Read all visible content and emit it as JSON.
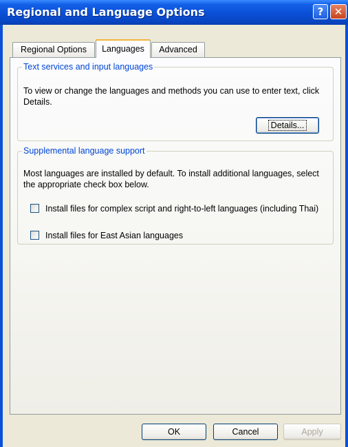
{
  "window": {
    "title": "Regional and Language Options",
    "help_glyph": "?",
    "close_glyph": "✕"
  },
  "tabs": [
    {
      "label": "Regional Options",
      "active": false
    },
    {
      "label": "Languages",
      "active": true
    },
    {
      "label": "Advanced",
      "active": false
    }
  ],
  "text_services": {
    "legend": "Text services and input languages",
    "description": "To view or change the languages and methods you can use to enter text, click Details.",
    "details_button": "Details..."
  },
  "supplemental": {
    "legend": "Supplemental language support",
    "description": "Most languages are installed by default. To install additional languages, select the appropriate check box below.",
    "checkboxes": [
      {
        "label": "Install files for complex script and right-to-left languages (including Thai)",
        "checked": false
      },
      {
        "label": "Install files for East Asian languages",
        "checked": false
      }
    ]
  },
  "footer": {
    "ok": "OK",
    "cancel": "Cancel",
    "apply": "Apply",
    "apply_enabled": false
  },
  "colors": {
    "title_bar": "#0a4fd6",
    "group_legend": "#0046d5",
    "dialog_bg": "#ece9d8",
    "active_tab_accent": "#f4b43c"
  }
}
